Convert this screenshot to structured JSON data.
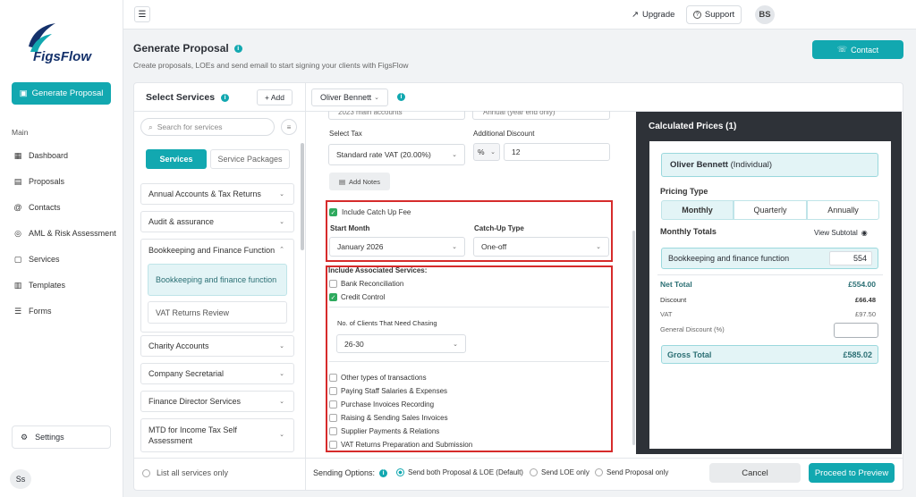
{
  "brand": {
    "logo_text": "FigsFlow",
    "accent": "#12a8b0"
  },
  "sidebar": {
    "generate_label": "Generate Proposal",
    "section_label": "Main",
    "items": [
      {
        "label": "Dashboard",
        "icon": "grid-icon"
      },
      {
        "label": "Proposals",
        "icon": "document-icon"
      },
      {
        "label": "Contacts",
        "icon": "at-icon"
      },
      {
        "label": "AML & Risk Assessment",
        "icon": "shield-icon"
      },
      {
        "label": "Services",
        "icon": "file-icon"
      },
      {
        "label": "Templates",
        "icon": "template-icon"
      },
      {
        "label": "Forms",
        "icon": "list-icon"
      }
    ],
    "settings_label": "Settings",
    "user_initials": "Ss"
  },
  "topbar": {
    "upgrade_label": "Upgrade",
    "support_label": "Support",
    "user_initials": "BS"
  },
  "header": {
    "title": "Generate Proposal",
    "subtitle": "Create proposals, LOEs and send email to start signing your clients with FigsFlow",
    "contact_label": "Contact"
  },
  "services_panel": {
    "title": "Select Services",
    "add_label": "+ Add",
    "search_placeholder": "Search for services",
    "tabs": {
      "active": "Services",
      "inactive": "Service Packages"
    },
    "groups": [
      {
        "label": "Annual Accounts & Tax Returns"
      },
      {
        "label": "Audit & assurance"
      },
      {
        "label": "Bookkeeping and Finance Function"
      },
      {
        "label": "Charity Accounts"
      },
      {
        "label": "Company Secretarial"
      },
      {
        "label": "Finance Director Services"
      },
      {
        "label": "MTD for Income Tax Self Assessment"
      }
    ],
    "subitems": {
      "selected": "Bookkeeping and finance function",
      "other": "VAT Returns Review"
    },
    "list_all_label": "List all services only"
  },
  "client": {
    "name": "Oliver Bennett"
  },
  "form": {
    "top_cut_left": "2023 main accounts",
    "top_cut_right": "Annual (year end only)",
    "select_tax_label": "Select Tax",
    "tax_value": "Standard rate VAT (20.00%)",
    "discount_label": "Additional Discount",
    "discount_unit": "%",
    "discount_value": "12",
    "notes_label": "Add Notes",
    "catchup_label": "Include Catch Up Fee",
    "start_month_label": "Start Month",
    "start_month_value": "January 2026",
    "catchup_type_label": "Catch-Up Type",
    "catchup_type_value": "One-off",
    "assoc_label": "Include Associated Services:",
    "assoc_items": [
      {
        "label": "Bank Reconciliation",
        "checked": false
      },
      {
        "label": "Credit Control",
        "checked": true
      }
    ],
    "clients_chasing_label": "No. of Clients That Need Chasing",
    "clients_chasing_value": "26-30",
    "more_items": [
      "Other types of transactions",
      "Paying Staff Salaries & Expenses",
      "Purchase Invoices Recording",
      "Raising & Sending Sales Invoices",
      "Supplier Payments & Relations",
      "VAT Returns Preparation and Submission"
    ]
  },
  "calc": {
    "title": "Calculated Prices (1)",
    "client_name": "Oliver Bennett",
    "client_type": "(Individual)",
    "pricing_type_label": "Pricing Type",
    "pricing_tabs": [
      "Monthly",
      "Quarterly",
      "Annually"
    ],
    "monthly_totals_label": "Monthly Totals",
    "view_subtotal_label": "View Subtotal",
    "service_label": "Bookkeeping and finance function",
    "service_value": "554",
    "net_total_label": "Net Total",
    "net_total_value": "£554.00",
    "discount_label": "Discount",
    "discount_value": "£66.48",
    "vat_label": "VAT",
    "vat_value": "£97.50",
    "general_discount_label": "General Discount (%)",
    "gross_total_label": "Gross Total",
    "gross_total_value": "£585.02"
  },
  "bottom": {
    "sending_options_label": "Sending Options:",
    "options": [
      "Send both Proposal & LOE (Default)",
      "Send LOE only",
      "Send Proposal only"
    ],
    "cancel_label": "Cancel",
    "proceed_label": "Proceed to Preview"
  }
}
